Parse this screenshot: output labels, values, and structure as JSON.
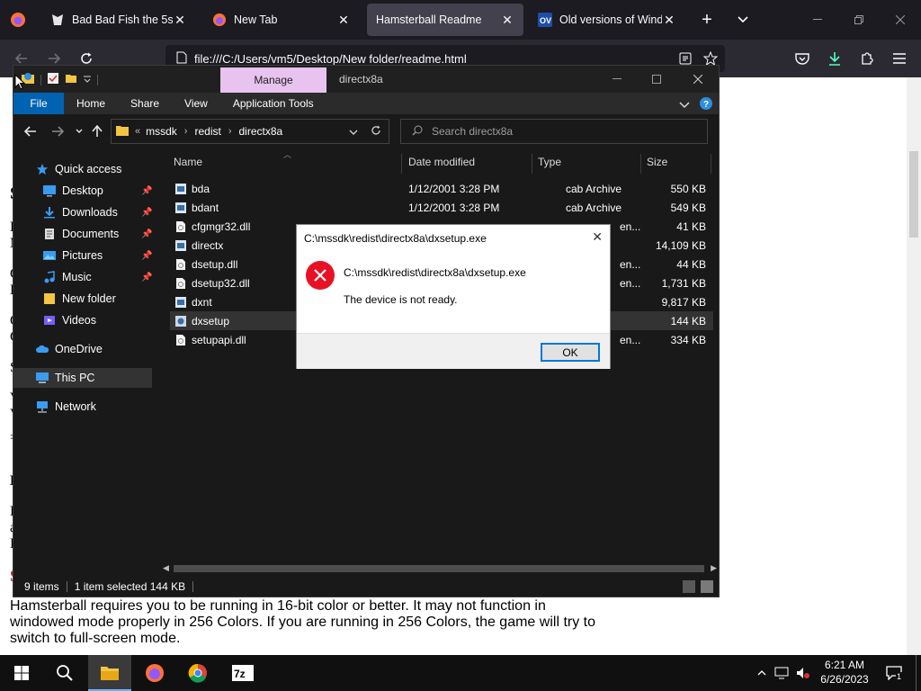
{
  "browser": {
    "tabs": [
      {
        "title": "Bad Bad Fish the 5st",
        "active": false
      },
      {
        "title": "New Tab",
        "active": false
      },
      {
        "title": "Hamsterball Readme",
        "active": true
      },
      {
        "title": "Old versions of Windo",
        "active": false
      }
    ],
    "url": "file:///C:/Users/vm5/Desktop/New folder/readme.html"
  },
  "page": {
    "paragraph": "Hamsterball requires you to be running in 16-bit color or better. It may not function in windowed mode properly in 256 Colors. If you are running in 256 Colors, the game will try to switch to full-screen mode.",
    "fragments": [
      "S",
      "H",
      "M",
      "C",
      "L",
      "C",
      "C",
      "S",
      "V",
      "V",
      "=",
      "D",
      "H",
      "a",
      "D",
      "S"
    ]
  },
  "explorer": {
    "ribbon_context_label": "Manage",
    "window_title": "directx8a",
    "ribbon_tabs": {
      "file": "File",
      "home": "Home",
      "share": "Share",
      "view": "View",
      "app_tools": "Application Tools"
    },
    "breadcrumb": [
      "mssdk",
      "redist",
      "directx8a"
    ],
    "search_placeholder": "Search directx8a",
    "columns": {
      "name": "Name",
      "date": "Date modified",
      "type": "Type",
      "size": "Size"
    },
    "nav": [
      {
        "label": "Quick access",
        "icon": "star-icon",
        "pinned": false
      },
      {
        "label": "Desktop",
        "icon": "desktop-icon",
        "pinned": true
      },
      {
        "label": "Downloads",
        "icon": "download-icon",
        "pinned": true
      },
      {
        "label": "Documents",
        "icon": "documents-icon",
        "pinned": true
      },
      {
        "label": "Pictures",
        "icon": "pictures-icon",
        "pinned": true
      },
      {
        "label": "Music",
        "icon": "music-icon",
        "pinned": true
      },
      {
        "label": "New folder",
        "icon": "folder-icon",
        "pinned": false
      },
      {
        "label": "Videos",
        "icon": "videos-icon",
        "pinned": false
      },
      {
        "label": "OneDrive",
        "icon": "cloud-icon",
        "pinned": false
      },
      {
        "label": "This PC",
        "icon": "computer-icon",
        "pinned": false
      },
      {
        "label": "Network",
        "icon": "network-icon",
        "pinned": false
      }
    ],
    "files": [
      {
        "name": "bda",
        "date": "1/12/2001 3:28 PM",
        "type": "cab Archive",
        "size": "550 KB",
        "icon": "cab-file-icon"
      },
      {
        "name": "bdant",
        "date": "1/12/2001 3:28 PM",
        "type": "cab Archive",
        "size": "549 KB",
        "icon": "cab-file-icon"
      },
      {
        "name": "cfgmgr32.dll",
        "date": "",
        "type": "en...",
        "size": "41 KB",
        "icon": "dll-file-icon"
      },
      {
        "name": "directx",
        "date": "",
        "type": "",
        "size": "14,109 KB",
        "icon": "cab-file-icon"
      },
      {
        "name": "dsetup.dll",
        "date": "",
        "type": "en...",
        "size": "44 KB",
        "icon": "dll-file-icon"
      },
      {
        "name": "dsetup32.dll",
        "date": "",
        "type": "en...",
        "size": "1,731 KB",
        "icon": "dll-file-icon"
      },
      {
        "name": "dxnt",
        "date": "",
        "type": "",
        "size": "9,817 KB",
        "icon": "cab-file-icon"
      },
      {
        "name": "dxsetup",
        "date": "",
        "type": "",
        "size": "144 KB",
        "icon": "setup-exe-icon",
        "selected": true
      },
      {
        "name": "setupapi.dll",
        "date": "",
        "type": "en...",
        "size": "334 KB",
        "icon": "dll-file-icon"
      }
    ],
    "status": {
      "items": "9 items",
      "selected": "1 item selected  144 KB"
    }
  },
  "dialog": {
    "title": "C:\\mssdk\\redist\\directx8a\\dxsetup.exe",
    "path": "C:\\mssdk\\redist\\directx8a\\dxsetup.exe",
    "message": "The device is not ready.",
    "ok": "OK"
  },
  "taskbar": {
    "time": "6:21 AM",
    "date": "6/26/2023",
    "notification_count": "1"
  },
  "colors": {
    "accent": "#0078d7",
    "manage": "#e8c3ef",
    "error": "#e81123",
    "file_tab": "#0063b1"
  }
}
